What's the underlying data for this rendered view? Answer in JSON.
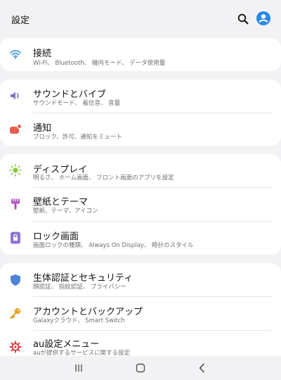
{
  "header": {
    "title": "設定",
    "search_icon": "search-icon",
    "avatar_icon": "account-icon",
    "accent": "#2a89e8"
  },
  "cards": [
    {
      "items": [
        {
          "label": "接続",
          "sub": "Wi-Fi、 Bluetooth、 機内モード、 データ使用量",
          "icon": "wifi-icon",
          "color": "#3b8fd9"
        }
      ]
    },
    {
      "items": [
        {
          "label": "サウンドとバイブ",
          "sub": "サウンドモード、 着信音、 音量",
          "icon": "speaker-icon",
          "color": "#7b73d0"
        },
        {
          "label": "通知",
          "sub": "ブロック、許可、通知をミュート",
          "icon": "notification-icon",
          "color": "#e85d4f"
        }
      ]
    },
    {
      "items": [
        {
          "label": "ディスプレイ",
          "sub": "明るさ、 ホーム画面、 フロント画面のアプリを設定",
          "icon": "brightness-icon",
          "color": "#8ac53e"
        },
        {
          "label": "壁紙とテーマ",
          "sub": "壁紙、テーマ、アイコン",
          "icon": "brush-icon",
          "color": "#b14fc2"
        },
        {
          "label": "ロック画面",
          "sub": "画面ロックの種類、 Always On Display、 時計のスタイル",
          "icon": "lock-icon",
          "color": "#8e74d6"
        }
      ]
    },
    {
      "items": [
        {
          "label": "生体認証とセキュリティ",
          "sub": "顔認証、 指紋認証、 プライバシー",
          "icon": "shield-icon",
          "color": "#4f83d8"
        },
        {
          "label": "アカウントとバックアップ",
          "sub": "Galaxyクラウド、 Smart Switch",
          "icon": "key-icon",
          "color": "#e4a325"
        },
        {
          "label": "au設定メニュー",
          "sub": "auが提供するサービスに関する設定",
          "icon": "gear-icon",
          "color": "#e0343d"
        }
      ]
    }
  ],
  "navbar": {
    "recents_icon": "recents-icon",
    "home_icon": "home-icon",
    "back_icon": "back-icon"
  }
}
